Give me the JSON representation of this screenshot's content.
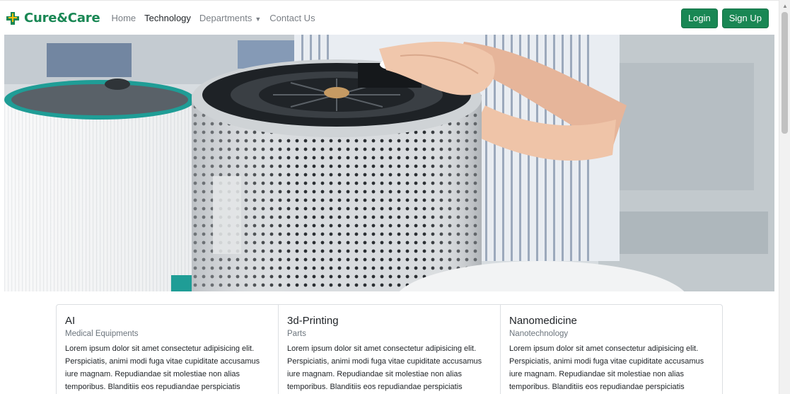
{
  "brand": {
    "name": "Cure&Care",
    "icon": "medical-cross-icon",
    "color": "#198754"
  },
  "nav": {
    "links": [
      {
        "label": "Home",
        "active": false
      },
      {
        "label": "Technology",
        "active": true
      },
      {
        "label": "Departments",
        "active": false,
        "dropdown": true
      },
      {
        "label": "Contact Us",
        "active": false
      }
    ],
    "login_label": "Login",
    "signup_label": "Sign Up"
  },
  "hero": {
    "image": "air-purifier-filter-photo"
  },
  "cards": [
    {
      "title": "AI",
      "subtitle": "Medical Equipments",
      "text": "Lorem ipsum dolor sit amet consectetur adipisicing elit. Perspiciatis, animi modi fuga vitae cupiditate accusamus iure magnam. Repudiandae sit molestiae non alias temporibus. Blanditiis eos repudiandae perspiciatis"
    },
    {
      "title": "3d-Printing",
      "subtitle": "Parts",
      "text": "Lorem ipsum dolor sit amet consectetur adipisicing elit. Perspiciatis, animi modi fuga vitae cupiditate accusamus iure magnam. Repudiandae sit molestiae non alias temporibus. Blanditiis eos repudiandae perspiciatis"
    },
    {
      "title": "Nanomedicine",
      "subtitle": "Nanotechnology",
      "text": "Lorem ipsum dolor sit amet consectetur adipisicing elit. Perspiciatis, animi modi fuga vitae cupiditate accusamus iure magnam. Repudiandae sit molestiae non alias temporibus. Blanditiis eos repudiandae perspiciatis"
    }
  ]
}
